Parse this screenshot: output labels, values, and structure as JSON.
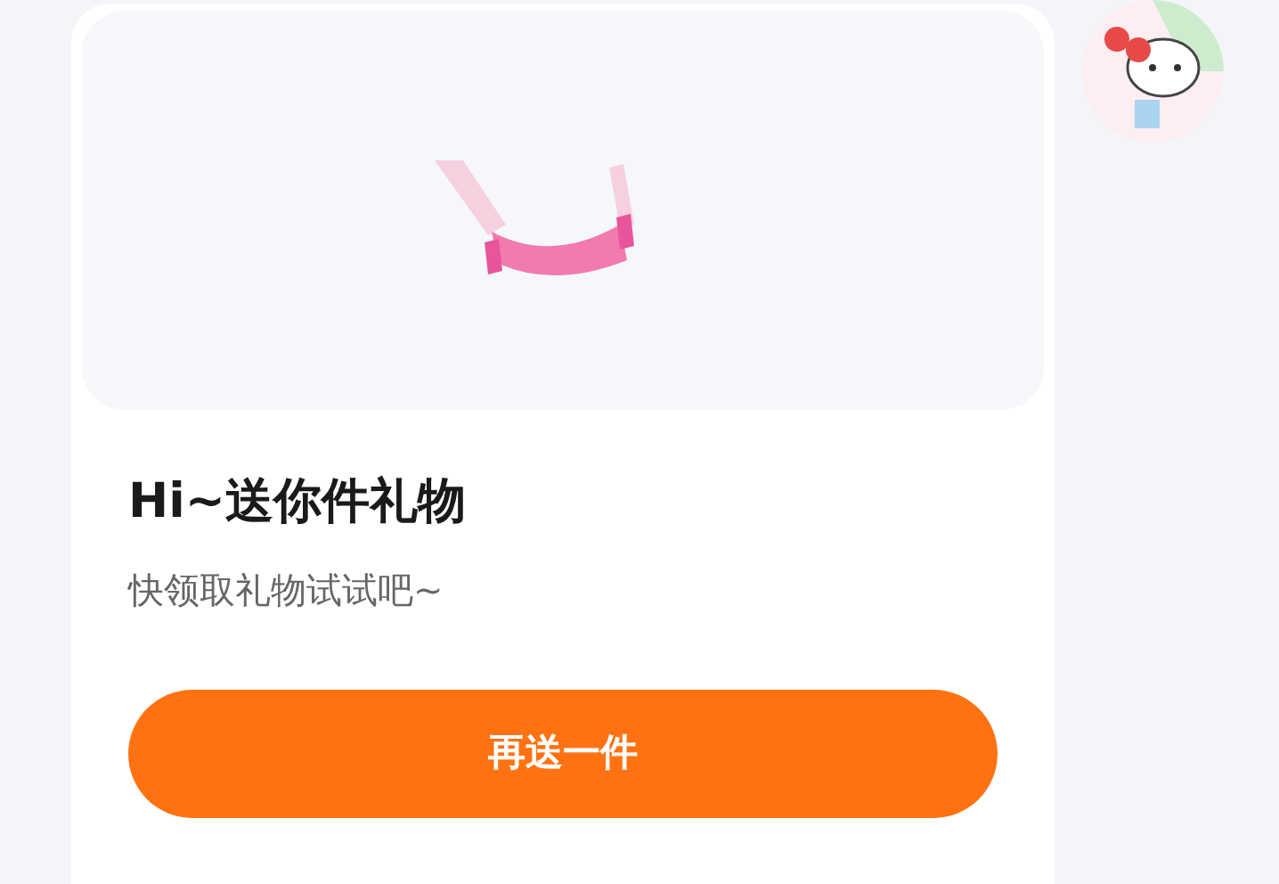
{
  "title": "Hi~送你件礼物",
  "subtitle": "快领取礼物试试吧~",
  "button": {
    "label": "再送一件"
  }
}
